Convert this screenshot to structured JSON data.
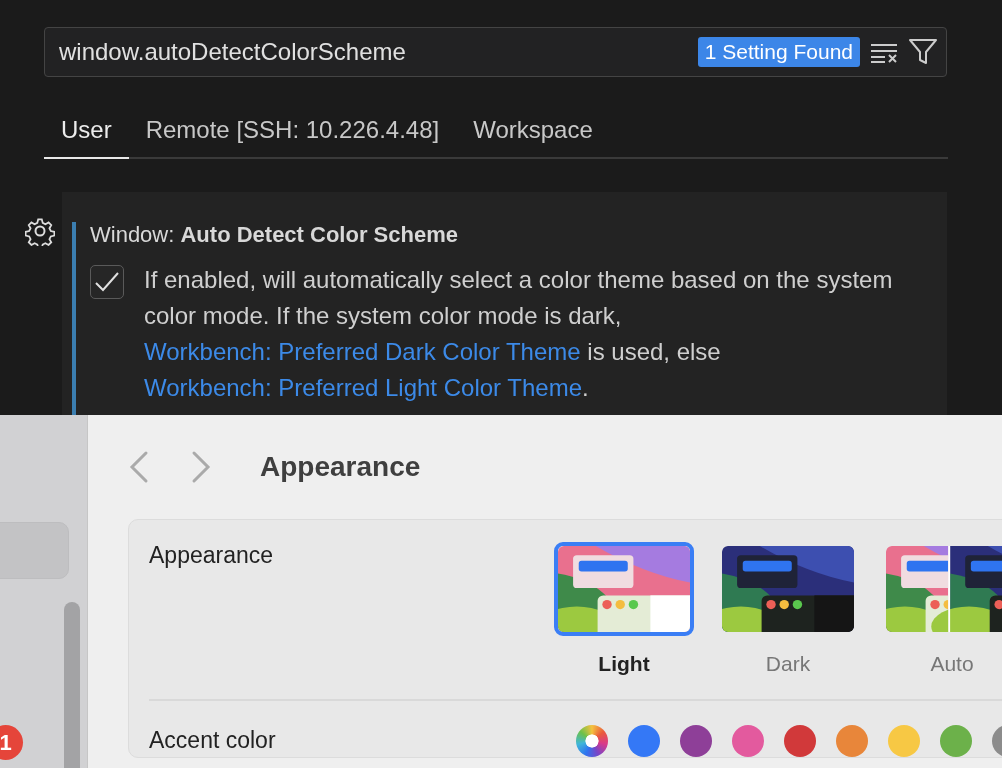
{
  "search": {
    "value": "window.autoDetectColorScheme",
    "result_badge": "1 Setting Found"
  },
  "tabs": [
    {
      "label": "User",
      "selected": true
    },
    {
      "label": "Remote [SSH: 10.226.4.48]",
      "selected": false
    },
    {
      "label": "Workspace",
      "selected": false
    }
  ],
  "setting": {
    "title_prefix": "Window: ",
    "title": "Auto Detect Color Scheme",
    "checked": true,
    "description": [
      {
        "kind": "text",
        "text": "If enabled, will automatically select a color theme based on the system color mode. If the system color mode is dark, "
      },
      {
        "kind": "link",
        "text": "Workbench: Preferred Dark Color Theme"
      },
      {
        "kind": "text",
        "text": " is used, else "
      },
      {
        "kind": "link",
        "text": "Workbench: Preferred Light Color Theme"
      },
      {
        "kind": "text",
        "text": "."
      }
    ]
  },
  "system_settings": {
    "sidebar": {
      "badge": "1"
    },
    "title": "Appearance",
    "appearance": {
      "label": "Appearance",
      "options": [
        {
          "kind": "light",
          "label": "Light",
          "selected": true
        },
        {
          "kind": "dark",
          "label": "Dark",
          "selected": false
        },
        {
          "kind": "auto",
          "label": "Auto",
          "selected": false
        }
      ]
    },
    "accent": {
      "label": "Accent color",
      "colors": [
        {
          "kind": "multicolor"
        },
        {
          "kind": "solid",
          "color": "#3478f6"
        },
        {
          "kind": "solid",
          "color": "#8e3f98"
        },
        {
          "kind": "solid",
          "color": "#e35a9e"
        },
        {
          "kind": "solid",
          "color": "#d1393a"
        },
        {
          "kind": "solid",
          "color": "#e8863a"
        },
        {
          "kind": "solid",
          "color": "#f7c844"
        },
        {
          "kind": "solid",
          "color": "#6cb14a"
        },
        {
          "kind": "solid",
          "color": "#8c8c8c"
        }
      ]
    }
  }
}
